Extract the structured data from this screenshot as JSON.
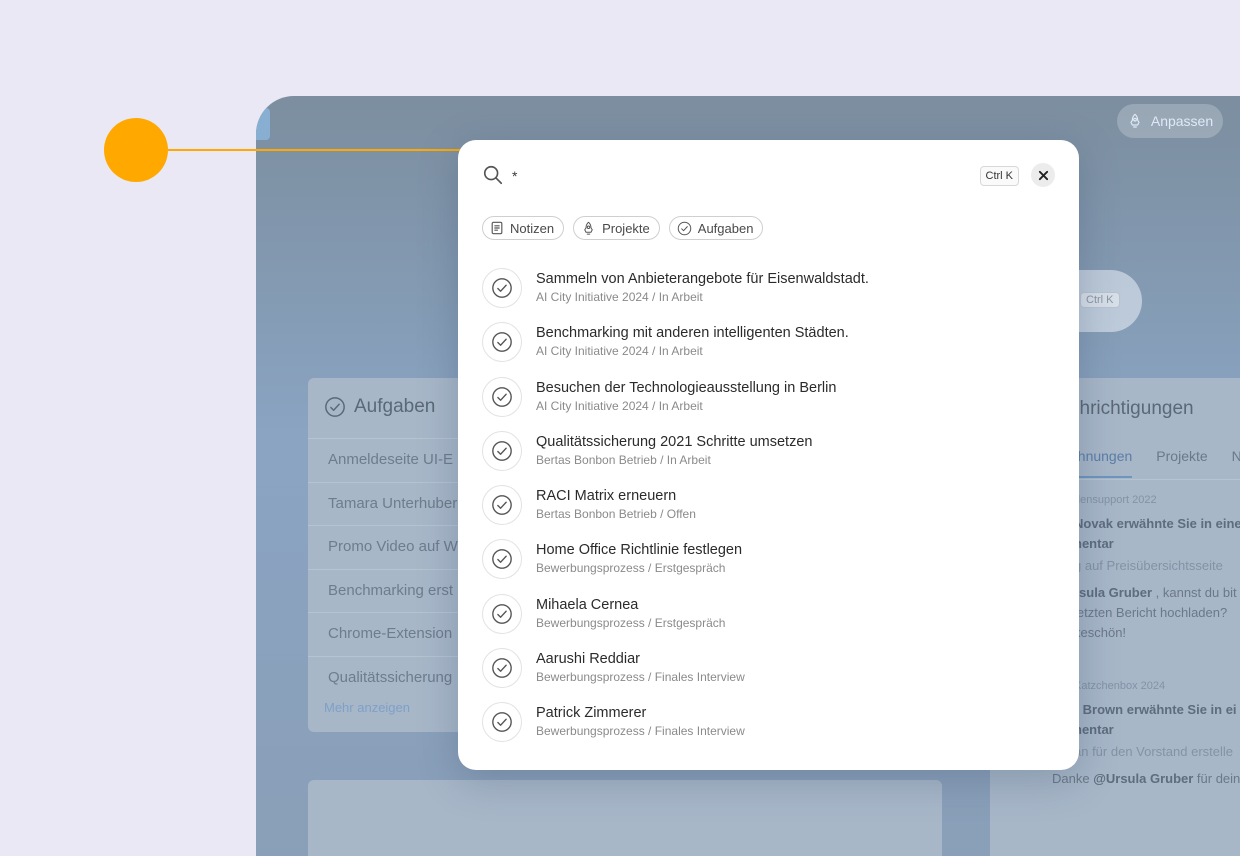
{
  "background_app": {
    "customize_label": "Anpassen",
    "search_shortcut": "Ctrl K",
    "tasks_card": {
      "title": "Aufgaben",
      "rows": [
        "Anmeldeseite UI-E",
        "Tamara Unterhuber",
        "Promo Video auf W",
        "Benchmarking erst",
        "Chrome-Extension",
        "Qualitätssicherung"
      ],
      "more_label": "Mehr anzeigen"
    },
    "notifications_card": {
      "title": "chrichtigungen",
      "tabs": [
        "ähnungen",
        "Projekte",
        "N"
      ],
      "items": [
        {
          "project": "densupport 2022",
          "headline_1": "Novak erwähnte Sie in eine",
          "headline_2": "nentar",
          "context": "g auf Preisübersichtsseite",
          "quote_name": "rsula Gruber",
          "quote_1": " , kannst du bit",
          "quote_2": "letzten Bericht hochladen?",
          "quote_3": "keschön!"
        },
        {
          "project": "Katzchenbox 2024",
          "headline_1": "r Brown erwähnte Sie in ei",
          "headline_2": "nentar",
          "context": "an für den Vorstand erstelle",
          "quote_prefix": "Danke ",
          "quote_name": "@Ursula Gruber",
          "quote_suffix": " für dein"
        }
      ]
    }
  },
  "search_modal": {
    "query": "*",
    "shortcut_label": "Ctrl K",
    "filters": [
      {
        "label": "Notizen",
        "icon": "note-icon"
      },
      {
        "label": "Projekte",
        "icon": "rocket-icon"
      },
      {
        "label": "Aufgaben",
        "icon": "check-circle-icon"
      }
    ],
    "results": [
      {
        "title": "Sammeln von Anbieterangebote für Eisenwaldstadt.",
        "subtitle": "AI City Initiative 2024 / In Arbeit"
      },
      {
        "title": "Benchmarking mit anderen intelligenten Städten.",
        "subtitle": "AI City Initiative 2024 / In Arbeit"
      },
      {
        "title": "Besuchen der Technologieausstellung in Berlin",
        "subtitle": "AI City Initiative 2024 / In Arbeit"
      },
      {
        "title": "Qualitätssicherung 2021 Schritte umsetzen",
        "subtitle": "Bertas Bonbon Betrieb / In Arbeit"
      },
      {
        "title": "RACI Matrix erneuern",
        "subtitle": "Bertas Bonbon Betrieb / Offen"
      },
      {
        "title": "Home Office Richtlinie festlegen",
        "subtitle": "Bewerbungsprozess / Erstgespräch"
      },
      {
        "title": "Mihaela Cernea",
        "subtitle": "Bewerbungsprozess / Erstgespräch"
      },
      {
        "title": "Aarushi Reddiar",
        "subtitle": "Bewerbungsprozess / Finales Interview"
      },
      {
        "title": "Patrick Zimmerer",
        "subtitle": "Bewerbungsprozess / Finales Interview"
      }
    ]
  },
  "colors": {
    "page_background": "#e9e8f4",
    "callout": "#fea800",
    "overlay_tint": "#8aa4c2"
  }
}
